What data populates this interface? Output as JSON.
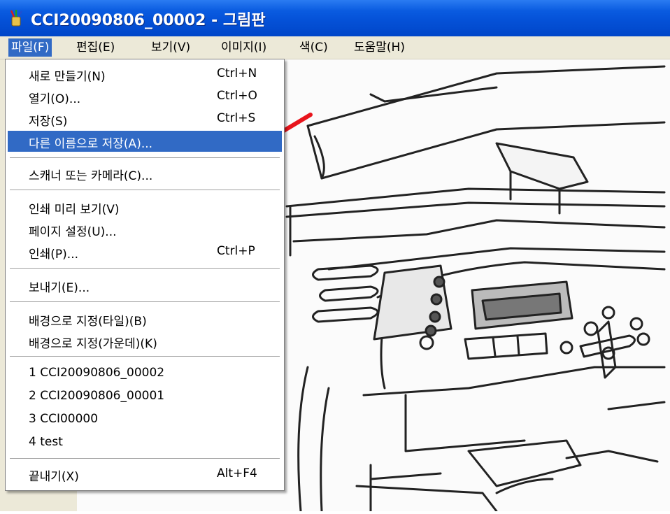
{
  "window": {
    "title": "CCI20090806_00002 - 그림판"
  },
  "menubar": {
    "items": [
      {
        "label": "파일(F)"
      },
      {
        "label": "편집(E)"
      },
      {
        "label": "보기(V)"
      },
      {
        "label": "이미지(I)"
      },
      {
        "label": "색(C)"
      },
      {
        "label": "도움말(H)"
      }
    ]
  },
  "file_menu": {
    "items": [
      {
        "label": "새로 만들기(N)",
        "shortcut": "Ctrl+N"
      },
      {
        "label": "열기(O)...",
        "shortcut": "Ctrl+O"
      },
      {
        "label": "저장(S)",
        "shortcut": "Ctrl+S"
      },
      {
        "label": "다른 이름으로 저장(A)...",
        "shortcut": ""
      },
      {
        "label": "스캐너 또는 카메라(C)...",
        "shortcut": ""
      },
      {
        "label": "인쇄 미리 보기(V)",
        "shortcut": ""
      },
      {
        "label": "페이지 설정(U)...",
        "shortcut": ""
      },
      {
        "label": "인쇄(P)...",
        "shortcut": "Ctrl+P"
      },
      {
        "label": "보내기(E)...",
        "shortcut": ""
      },
      {
        "label": "배경으로 지정(타일)(B)",
        "shortcut": ""
      },
      {
        "label": "배경으로 지정(가운데)(K)",
        "shortcut": ""
      },
      {
        "label": "1 CCI20090806_00002",
        "shortcut": ""
      },
      {
        "label": "2 CCI20090806_00001",
        "shortcut": ""
      },
      {
        "label": "3 CCI00000",
        "shortcut": ""
      },
      {
        "label": "4 test",
        "shortcut": ""
      },
      {
        "label": "끝내기(X)",
        "shortcut": "Alt+F4"
      }
    ]
  },
  "colors": {
    "titlebar": "#0450d6",
    "highlight": "#316ac5",
    "menubar": "#ece9d8",
    "arrow": "#e8141c"
  },
  "icons": {
    "app": "paint-brush-cup-icon",
    "annotation": "red-arrow-icon"
  }
}
